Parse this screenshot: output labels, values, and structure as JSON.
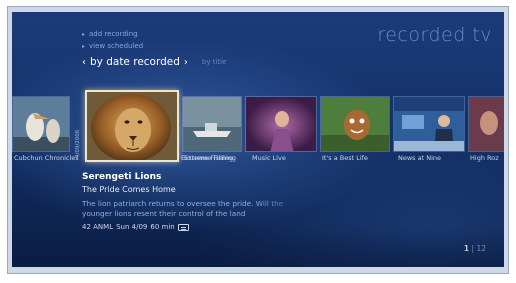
{
  "header": {
    "title": "recorded tv"
  },
  "tasks": [
    {
      "label": "add recording"
    },
    {
      "label": "view scheduled"
    }
  ],
  "sort": {
    "left_arrow": "‹",
    "current": "by date recorded",
    "right_arrow": "›",
    "alternate": "by title"
  },
  "thumbnails": [
    {
      "label": "Cubchun Chronicles"
    },
    {
      "label": "Serengeti Lions"
    },
    {
      "label": "Extreme Fishing"
    },
    {
      "label": "Music Live"
    },
    {
      "label": "It's a Best Life"
    },
    {
      "label": "News at Nine"
    },
    {
      "label": "High Roz"
    }
  ],
  "strip_date": "4/09/2006",
  "details": {
    "title": "Serengeti Lions",
    "episode": "The Pride Comes Home",
    "description": "The lion patriarch returns to oversee the pride. Will the younger lions resent their control of the land",
    "channel": "42 ANML",
    "date": "Sun 4/09",
    "duration": "60 min"
  },
  "pager": {
    "current": "1",
    "separator": "|",
    "total": "12"
  },
  "colors": {
    "accent": "#7fa7e4",
    "background": "#16336c",
    "focus_border": "#f0e6c8"
  }
}
